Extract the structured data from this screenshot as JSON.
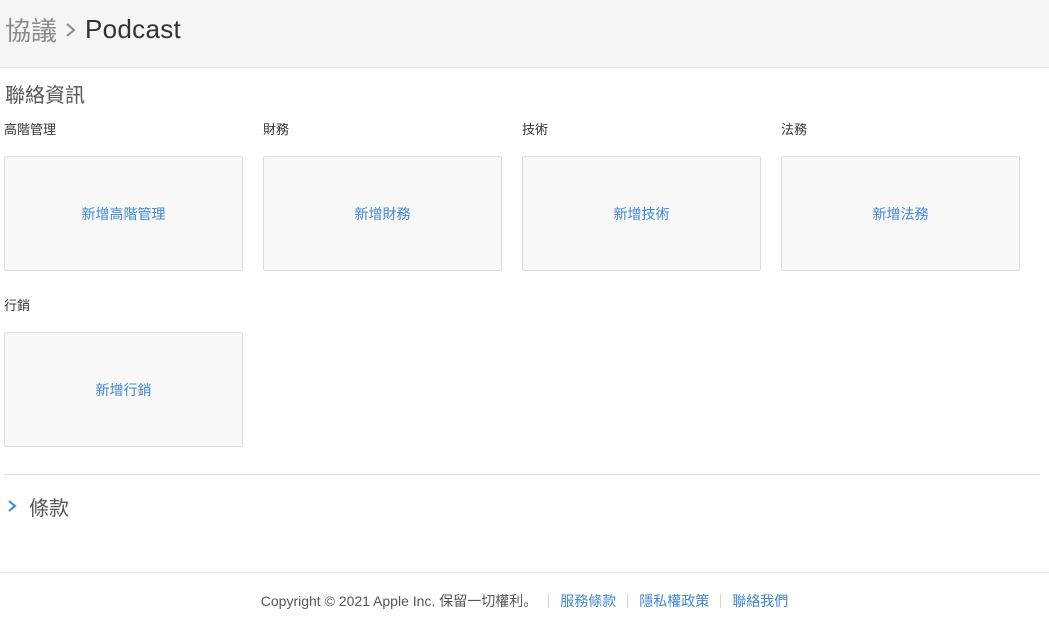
{
  "header": {
    "breadcrumb_root": "協議",
    "breadcrumb_current": "Podcast"
  },
  "contact": {
    "title": "聯絡資訊",
    "groups": [
      {
        "label": "高階管理",
        "add_label": "新增高階管理"
      },
      {
        "label": "財務",
        "add_label": "新增財務"
      },
      {
        "label": "技術",
        "add_label": "新增技術"
      },
      {
        "label": "法務",
        "add_label": "新增法務"
      },
      {
        "label": "行銷",
        "add_label": "新增行銷"
      }
    ]
  },
  "terms": {
    "label": "條款"
  },
  "footer": {
    "copyright": "Copyright © 2021 Apple Inc. 保留一切權利。",
    "links": [
      "服務條款",
      "隱私權政策",
      "聯絡我們"
    ]
  },
  "colors": {
    "accent": "#3f86d3",
    "header_bg": "#f5f5f5",
    "card_bg": "#f8f8f8"
  },
  "icons": {
    "breadcrumb_separator": "chevron-right-icon",
    "terms_toggle": "chevron-right-icon"
  }
}
